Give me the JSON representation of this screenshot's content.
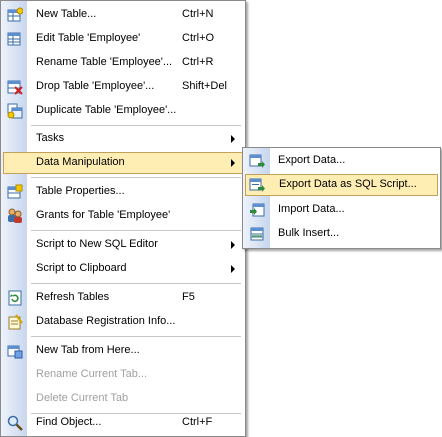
{
  "main_menu": {
    "items": [
      {
        "label": "New Table...",
        "shortcut": "Ctrl+N",
        "icon": "new-table-icon"
      },
      {
        "label": "Edit Table 'Employee'",
        "shortcut": "Ctrl+O",
        "icon": "edit-table-icon"
      },
      {
        "label": "Rename Table 'Employee'...",
        "shortcut": "Ctrl+R"
      },
      {
        "label": "Drop Table 'Employee'...",
        "shortcut": "Shift+Del",
        "icon": "drop-table-icon"
      },
      {
        "label": "Duplicate Table 'Employee'...",
        "icon": "duplicate-table-icon"
      },
      {
        "label": "Tasks",
        "submenu": true
      },
      {
        "label": "Data Manipulation",
        "submenu": true,
        "highlighted": true
      },
      {
        "label": "Table Properties...",
        "icon": "table-properties-icon"
      },
      {
        "label": "Grants for Table 'Employee'",
        "icon": "grants-icon"
      },
      {
        "label": "Script to New SQL Editor",
        "submenu": true
      },
      {
        "label": "Script to Clipboard",
        "submenu": true
      },
      {
        "label": "Refresh Tables",
        "shortcut": "F5",
        "icon": "refresh-icon"
      },
      {
        "label": "Database Registration Info...",
        "icon": "registration-info-icon"
      },
      {
        "label": "New Tab from Here...",
        "icon": "new-tab-icon"
      },
      {
        "label": "Rename Current Tab...",
        "disabled": true
      },
      {
        "label": "Delete Current Tab",
        "disabled": true
      },
      {
        "label": "Find Object...",
        "shortcut": "Ctrl+F",
        "icon": "find-object-icon"
      }
    ]
  },
  "submenu": {
    "items": [
      {
        "label": "Export Data...",
        "icon": "export-data-icon"
      },
      {
        "label": "Export Data as SQL Script...",
        "icon": "export-sql-icon",
        "highlighted": true
      },
      {
        "label": "Import Data...",
        "icon": "import-data-icon"
      },
      {
        "label": "Bulk Insert...",
        "icon": "bulk-insert-icon"
      }
    ]
  },
  "colors": {
    "highlight_bg": "#ffeeb4",
    "highlight_border": "#c2a25a",
    "gutter_light": "#eef3fb",
    "gutter_dark": "#c7d6ee",
    "disabled_text": "#a0a0a0"
  }
}
